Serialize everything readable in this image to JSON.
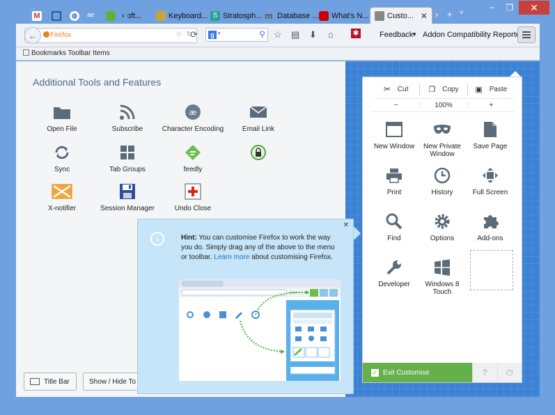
{
  "window": {
    "minimize": "−",
    "restore": "❐",
    "close": "✕"
  },
  "tabs": [
    {
      "label": "",
      "color": "#d93025"
    },
    {
      "label": "",
      "color": "#2b5797"
    },
    {
      "label": "",
      "color": "#1a73e8"
    },
    {
      "label": "",
      "color": "#4a90d9"
    },
    {
      "label": "",
      "color": "#5fb336"
    },
    {
      "label": "ɔft...",
      "color": "#ffffff"
    },
    {
      "label": "Keyboard...",
      "color": "#c9a43b"
    },
    {
      "label": "Stratosph...",
      "color": "#2aa198"
    },
    {
      "label": "Database ...",
      "color": "#555555"
    },
    {
      "label": "What's N...",
      "color": "#cc0000"
    },
    {
      "label": "Custo...",
      "color": "#888888",
      "active": true
    }
  ],
  "tab_controls": {
    "scroll": "›",
    "new": "+",
    "list": "˅"
  },
  "navbar": {
    "url_placeholder": "Firefox",
    "search_engine": "g",
    "feedback_label": "Feedback",
    "addon_label": "Addon Compatibility Reporter"
  },
  "bookmarks_toolbar": {
    "label": "Bookmarks Toolbar Items"
  },
  "palette": {
    "title": "Additional Tools and Features",
    "items": [
      {
        "label": "Open File",
        "icon": "folder-icon"
      },
      {
        "label": "Subscribe",
        "icon": "rss-icon"
      },
      {
        "label": "Character Encoding",
        "icon": "character-encoding-icon"
      },
      {
        "label": "Email Link",
        "icon": "envelope-icon"
      },
      {
        "label": "Sync",
        "icon": "sync-icon"
      },
      {
        "label": "Tab Groups",
        "icon": "tab-groups-icon"
      },
      {
        "label": "feedly",
        "icon": "feedly-icon"
      },
      {
        "label": "",
        "icon": "lock-shield-icon"
      },
      {
        "label": "X-notifier",
        "icon": "x-notifier-icon"
      },
      {
        "label": "Session Manager",
        "icon": "floppy-icon"
      },
      {
        "label": "Undo Close",
        "icon": "undo-close-icon"
      }
    ],
    "title_bar_button": "Title Bar",
    "show_hide_button": "Show / Hide To"
  },
  "panel": {
    "cut": "Cut",
    "copy": "Copy",
    "paste": "Paste",
    "zoom_out": "−",
    "zoom_level": "100%",
    "zoom_in": "+",
    "items": [
      {
        "label": "New Window",
        "icon": "new-window-icon"
      },
      {
        "label": "New Private Window",
        "icon": "mask-icon"
      },
      {
        "label": "Save Page",
        "icon": "page-icon"
      },
      {
        "label": "Print",
        "icon": "printer-icon"
      },
      {
        "label": "History",
        "icon": "clock-icon"
      },
      {
        "label": "Full Screen",
        "icon": "fullscreen-icon"
      },
      {
        "label": "Find",
        "icon": "magnifier-icon"
      },
      {
        "label": "Options",
        "icon": "gear-icon"
      },
      {
        "label": "Add-ons",
        "icon": "puzzle-icon"
      },
      {
        "label": "Developer",
        "icon": "wrench-icon"
      },
      {
        "label": "Windows 8 Touch",
        "icon": "windows-icon"
      }
    ],
    "exit_label": "Exit Customise"
  },
  "hint": {
    "bold": "Hint:",
    "text1": " You can customise Firefox to work the way you do. Simply drag any of the above to the menu or toolbar. ",
    "link": "Learn more",
    "text2": " about customising Firefox."
  }
}
